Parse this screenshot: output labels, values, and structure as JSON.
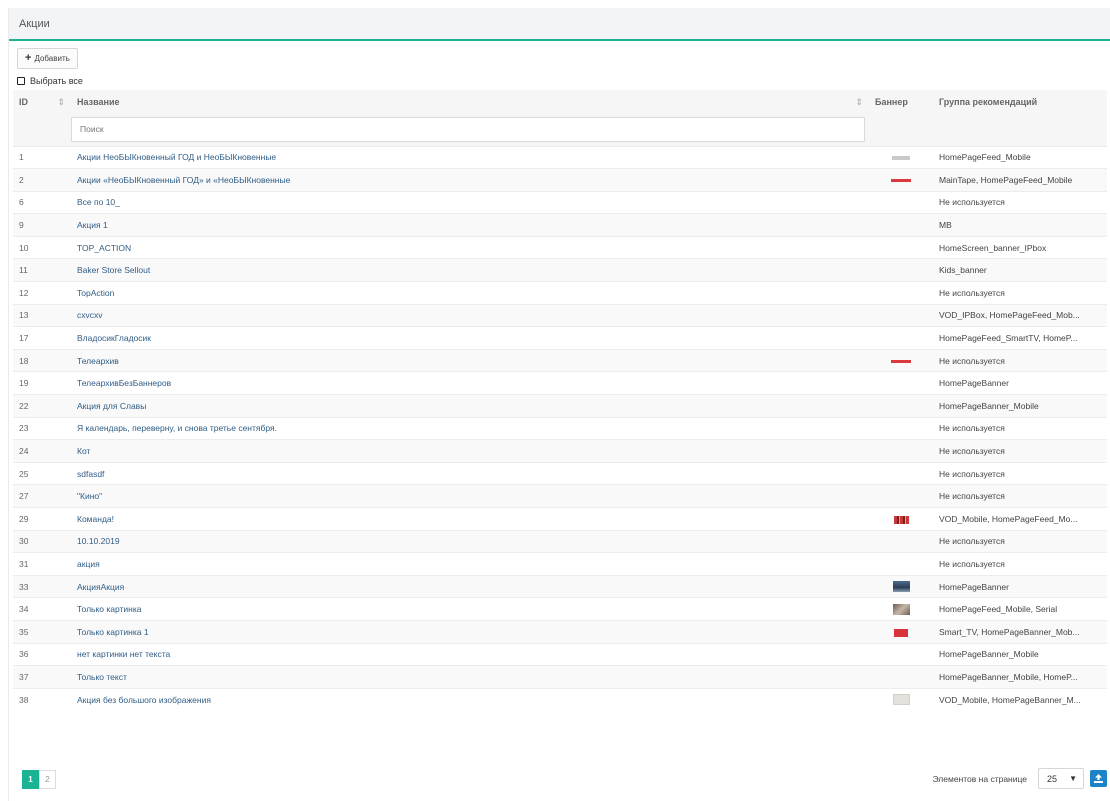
{
  "header": {
    "title": "Акции"
  },
  "toolbar": {
    "add_icon": "plus-icon",
    "add_label": "Добавить"
  },
  "select_all": {
    "label": "Выбрать все"
  },
  "table": {
    "columns": {
      "id": "ID",
      "name": "Название",
      "banner": "Баннер",
      "group": "Группа рекомендаций"
    },
    "search_placeholder": "Поиск",
    "rows": [
      {
        "id": "1",
        "name": "Акции НеоБЫКновенный ГОД и НеоБЫКновенные",
        "banner": "tiny",
        "group": "HomePageFeed_Mobile"
      },
      {
        "id": "2",
        "name": "Акции «НеоБЫКновенный ГОД» и «НеоБЫКновенные",
        "banner": "line",
        "group": "MainTape, HomePageFeed_Mobile"
      },
      {
        "id": "6",
        "name": "Все по 10_",
        "banner": "",
        "group": "Не используется"
      },
      {
        "id": "9",
        "name": "Акция 1",
        "banner": "",
        "group": "MB"
      },
      {
        "id": "10",
        "name": "TOP_ACTION",
        "banner": "",
        "group": "HomeScreen_banner_IPbox"
      },
      {
        "id": "11",
        "name": "Baker Store Sellout",
        "banner": "",
        "group": "Kids_banner"
      },
      {
        "id": "12",
        "name": "TopAction",
        "banner": "",
        "group": "Не используется"
      },
      {
        "id": "13",
        "name": "cxvcxv",
        "banner": "",
        "group": "VOD_IPBox, HomePageFeed_Mob..."
      },
      {
        "id": "17",
        "name": "ВладосикГладосик",
        "banner": "",
        "group": "HomePageFeed_SmartTV, HomeP..."
      },
      {
        "id": "18",
        "name": "Телеархив",
        "banner": "line",
        "group": "Не используется"
      },
      {
        "id": "19",
        "name": "ТелеархивБезБаннеров",
        "banner": "",
        "group": "HomePageBanner"
      },
      {
        "id": "22",
        "name": "Акция для Славы",
        "banner": "",
        "group": "HomePageBanner_Mobile"
      },
      {
        "id": "23",
        "name": "Я календарь, переверну, и снова третье сентября.",
        "banner": "",
        "group": "Не используется"
      },
      {
        "id": "24",
        "name": "Кот",
        "banner": "",
        "group": "Не используется"
      },
      {
        "id": "25",
        "name": "sdfasdf",
        "banner": "",
        "group": "Не используется"
      },
      {
        "id": "27",
        "name": "\"Кино\"",
        "banner": "",
        "group": "Не используется"
      },
      {
        "id": "29",
        "name": "Команда!",
        "banner": "mix",
        "group": "VOD_Mobile, HomePageFeed_Mo..."
      },
      {
        "id": "30",
        "name": "10.10.2019",
        "banner": "",
        "group": "Не используется"
      },
      {
        "id": "31",
        "name": "акция",
        "banner": "",
        "group": "Не используется"
      },
      {
        "id": "33",
        "name": "АкцияАкция",
        "banner": "blue",
        "group": "HomePageBanner"
      },
      {
        "id": "34",
        "name": "Только картинка",
        "banner": "grey",
        "group": "HomePageFeed_Mobile, Serial"
      },
      {
        "id": "35",
        "name": "Только картинка 1",
        "banner": "red",
        "group": "Smart_TV, HomePageBanner_Mob..."
      },
      {
        "id": "36",
        "name": "нет картинки нет текста",
        "banner": "",
        "group": "HomePageBanner_Mobile"
      },
      {
        "id": "37",
        "name": "Только текст",
        "banner": "",
        "group": "HomePageBanner_Mobile, HomeP..."
      },
      {
        "id": "38",
        "name": "Акция без большого изображения",
        "banner": "light",
        "group": "VOD_Mobile, HomePageBanner_M..."
      }
    ]
  },
  "pagination": {
    "pages": [
      "1",
      "2"
    ],
    "current": "1"
  },
  "per_page": {
    "label": "Элементов на странице",
    "value": "25",
    "export_icon": "export-icon"
  },
  "colors": {
    "accent": "#1ab394",
    "link": "#2f5d86",
    "export": "#1c84c6"
  }
}
